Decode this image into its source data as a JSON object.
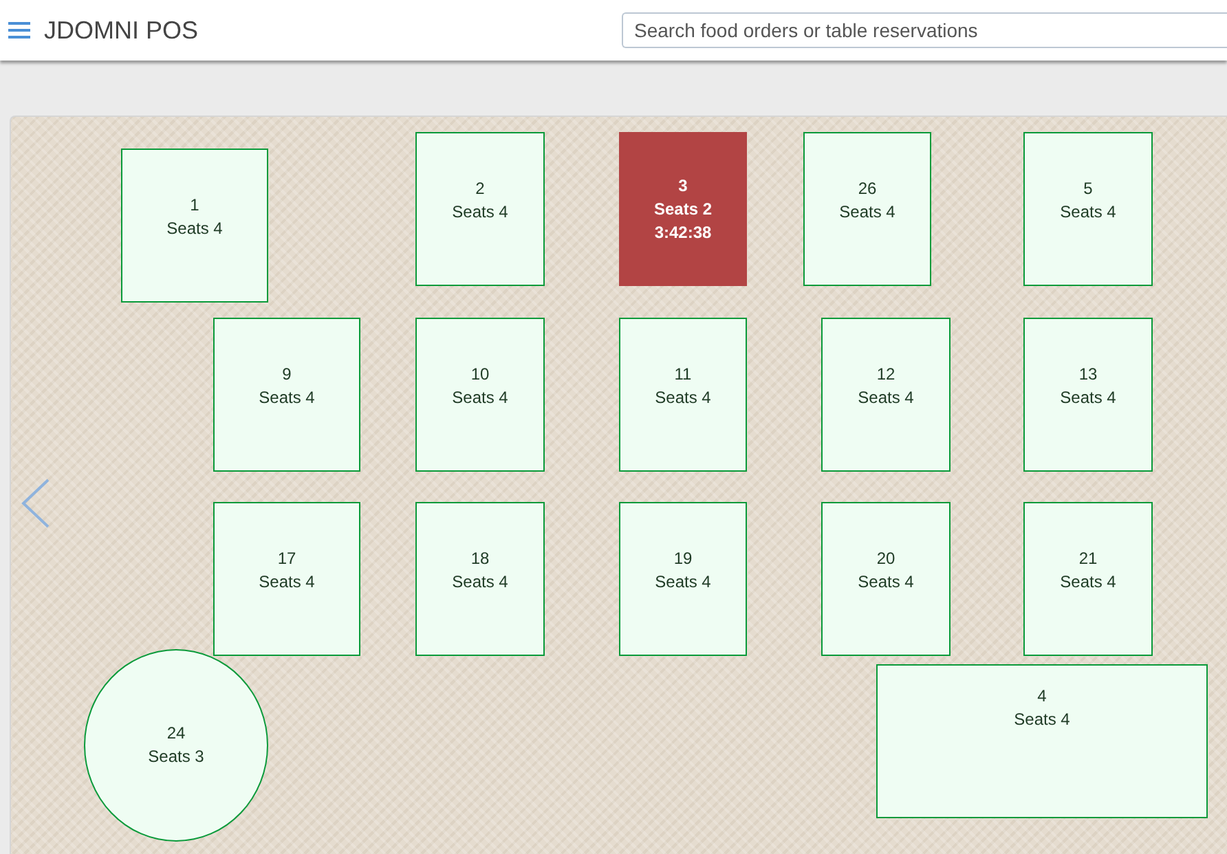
{
  "app": {
    "title": "JDOMNI POS"
  },
  "search": {
    "placeholder": "Search food orders or table reservations"
  },
  "tables": [
    {
      "number": "1",
      "seats": "Seats 4",
      "kind": "square",
      "occupied": false
    },
    {
      "number": "2",
      "seats": "Seats 4",
      "kind": "square",
      "occupied": false
    },
    {
      "number": "3",
      "seats": "Seats 2",
      "kind": "square",
      "occupied": true,
      "timer": "3:42:38"
    },
    {
      "number": "26",
      "seats": "Seats 4",
      "kind": "square",
      "occupied": false
    },
    {
      "number": "5",
      "seats": "Seats 4",
      "kind": "square",
      "occupied": false
    },
    {
      "number": "9",
      "seats": "Seats 4",
      "kind": "square",
      "occupied": false
    },
    {
      "number": "10",
      "seats": "Seats 4",
      "kind": "square",
      "occupied": false
    },
    {
      "number": "11",
      "seats": "Seats 4",
      "kind": "square",
      "occupied": false
    },
    {
      "number": "12",
      "seats": "Seats 4",
      "kind": "square",
      "occupied": false
    },
    {
      "number": "13",
      "seats": "Seats 4",
      "kind": "square",
      "occupied": false
    },
    {
      "number": "17",
      "seats": "Seats 4",
      "kind": "square",
      "occupied": false
    },
    {
      "number": "18",
      "seats": "Seats 4",
      "kind": "square",
      "occupied": false
    },
    {
      "number": "19",
      "seats": "Seats 4",
      "kind": "square",
      "occupied": false
    },
    {
      "number": "20",
      "seats": "Seats 4",
      "kind": "square",
      "occupied": false
    },
    {
      "number": "21",
      "seats": "Seats 4",
      "kind": "square",
      "occupied": false
    },
    {
      "number": "24",
      "seats": "Seats 3",
      "kind": "round",
      "occupied": false
    },
    {
      "number": "4",
      "seats": "Seats 4",
      "kind": "banquet",
      "occupied": false
    }
  ]
}
